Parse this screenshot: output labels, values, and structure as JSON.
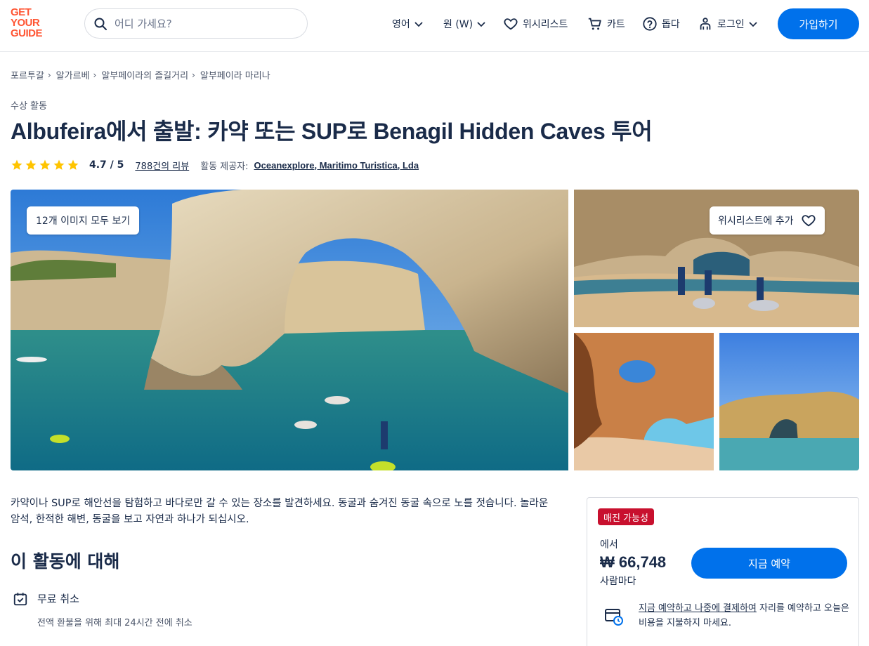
{
  "header": {
    "logo_lines": [
      "GET",
      "YOUR",
      "GUIDE"
    ],
    "search_placeholder": "어디 가세요?",
    "language_label": "영어",
    "currency_label": "원 (W)",
    "wishlist_label": "위시리스트",
    "cart_label": "카트",
    "help_label": "돕다",
    "login_label": "로그인",
    "signup_label": "가입하기",
    "brand_color": "#ff5533",
    "accent_color": "#0071eb"
  },
  "breadcrumb": [
    "포르투갈",
    "알가르베",
    "알부페이라의 즐길거리",
    "알부페이라 마리나"
  ],
  "category": "수상 활동",
  "title": "Albufeira에서 출발: 카약 또는 SUP로 Benagil Hidden Caves 투어",
  "rating": {
    "stars": 5,
    "value": "4.7 / 5",
    "reviews_label": "788건의 리뷰",
    "provider_label": "활동 제공자:",
    "provider_name": "Oceanexplore, Maritimo Turistica, Lda",
    "star_color": "#ffc400"
  },
  "gallery": {
    "see_all_label": "12개 이미지 모두 보기",
    "wishlist_add_label": "위시리스트에 추가",
    "images": [
      "kayakers-rock-arch",
      "kayaks-on-cave-beach",
      "benagil-cave-skylight",
      "coastal-cliff-arch"
    ]
  },
  "description": "카약이나 SUP로 해안선을 탐험하고 바다로만 갈 수 있는 장소를 발견하세요. 동굴과 숨겨진 동굴 속으로 노를 젓습니다. 놀라운 암석, 한적한 해변, 동굴을 보고 자연과 하나가 되십시오.",
  "about": {
    "title": "이 활동에 대해",
    "features": [
      {
        "icon": "calendar-check-icon",
        "title": "무료 취소",
        "subtitle": "전액 환불을 위해 최대 24시간 전에 취소"
      }
    ]
  },
  "booking": {
    "badge": "매진 가능성",
    "badge_color": "#c8102e",
    "from_label": "에서",
    "price": "₩ 66,748",
    "per_person": "사람마다",
    "book_label": "지금 예약",
    "reserve_link": "지금 예약하고 나중에 결제하여",
    "reserve_text": " 자리를 예약하고 오늘은 비용을 지불하지 마세요."
  }
}
